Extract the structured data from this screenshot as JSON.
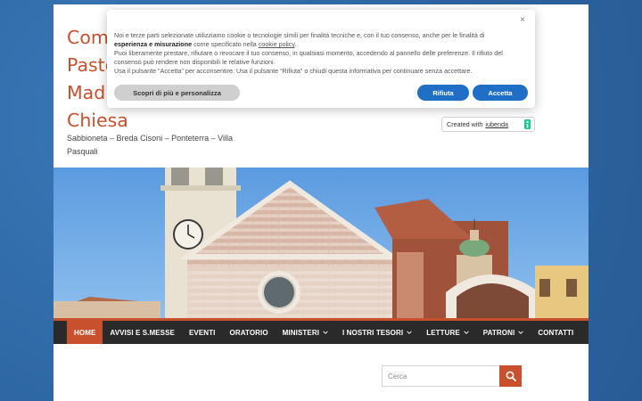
{
  "site": {
    "title_lines": [
      "Comunità",
      "Pastorale",
      "Madre della",
      "Chiesa"
    ],
    "tagline": "Sabbioneta – Breda Cisoni – Ponteterra – Villa Pasquali"
  },
  "nav": {
    "items": [
      {
        "label": "HOME",
        "active": true,
        "dropdown": false
      },
      {
        "label": "AVVISI E S.MESSE",
        "active": false,
        "dropdown": false
      },
      {
        "label": "EVENTI",
        "active": false,
        "dropdown": false
      },
      {
        "label": "ORATORIO",
        "active": false,
        "dropdown": false
      },
      {
        "label": "MINISTERI",
        "active": false,
        "dropdown": true
      },
      {
        "label": "I NOSTRI TESORI",
        "active": false,
        "dropdown": true
      },
      {
        "label": "LETTURE",
        "active": false,
        "dropdown": true
      },
      {
        "label": "PATRONI",
        "active": false,
        "dropdown": true
      },
      {
        "label": "CONTATTI",
        "active": false,
        "dropdown": false
      }
    ]
  },
  "search": {
    "placeholder": "Cerca",
    "icon": "search-icon"
  },
  "cookie_banner": {
    "line1_a": "Noi e terze parti selezionate utilizziamo cookie o tecnologie simili per finalità tecniche e, con il tuo consenso, anche per le finalità di ",
    "line1_bold": "esperienza e misurazione",
    "line1_b": " come specificato nella ",
    "line1_link": "cookie policy",
    "line1_end": ".",
    "line2": "Puoi liberamente prestare, rifiutare o revocare il tuo consenso, in qualsiasi momento, accedendo al pannello delle preferenze. Il rifiuto del consenso può rendere non disponibili le relative funzioni.",
    "line3": "Usa il pulsante “Accetta” per acconsentire. Usa il pulsante “Rifiuta” o chiudi questa informativa per continuare senza accettare.",
    "close_label": "×",
    "customize_label": "Scopri di più e personalizza",
    "reject_label": "Rifiuta",
    "accept_label": "Accetta"
  },
  "iubenda_badge": {
    "prefix": "Created with",
    "brand": "iubenda"
  },
  "colors": {
    "accent": "#c8502c",
    "nav_bg": "#2a2a2a",
    "button_blue": "#1f6fc6",
    "page_bg": "#2f6aa8"
  }
}
